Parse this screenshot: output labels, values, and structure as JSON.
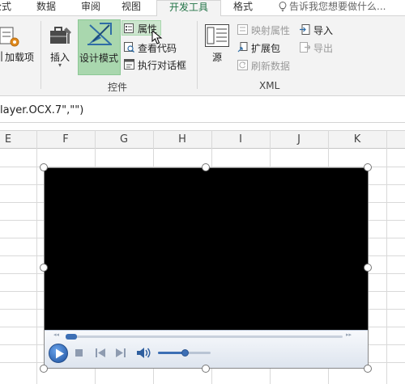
{
  "tabs": [
    {
      "label": "公式"
    },
    {
      "label": "数据"
    },
    {
      "label": "审阅"
    },
    {
      "label": "视图"
    },
    {
      "label": "开发工具",
      "active": true
    },
    {
      "label": "格式"
    }
  ],
  "tell_me": {
    "placeholder": "告诉我您想要做什么..."
  },
  "ribbon": {
    "addins_label": "加载项",
    "insert_label": "插入",
    "design_mode_label": "设计模式",
    "properties_label": "属性",
    "view_code_label": "查看代码",
    "run_dialog_label": "执行对话框",
    "controls_group": "控件",
    "source_label": "源",
    "map_properties_label": "映射属性",
    "expansion_pack_label": "扩展包",
    "refresh_data_label": "刷新数据",
    "import_label": "导入",
    "export_label": "导出",
    "xml_group": "XML"
  },
  "formula_bar": {
    "text": "layer.OCX.7\",\"\")"
  },
  "columns": [
    "E",
    "F",
    "G",
    "H",
    "I",
    "J",
    "K"
  ],
  "player": {
    "seek_progress": 0.04,
    "volume": 0.5
  },
  "colors": {
    "accent": "#217346",
    "design_active": "#a9d7ae",
    "player_blue": "#3d6fb5"
  },
  "icons": [
    "lightbulb-icon",
    "addins-icon",
    "toolbox-insert-icon",
    "design-mode-icon",
    "properties-icon",
    "view-code-icon",
    "run-dialog-icon",
    "xml-source-icon",
    "map-properties-icon",
    "expansion-pack-icon",
    "refresh-data-icon",
    "import-icon",
    "export-icon",
    "play-icon",
    "stop-icon",
    "previous-icon",
    "next-icon",
    "volume-icon",
    "mouse-cursor-icon"
  ]
}
